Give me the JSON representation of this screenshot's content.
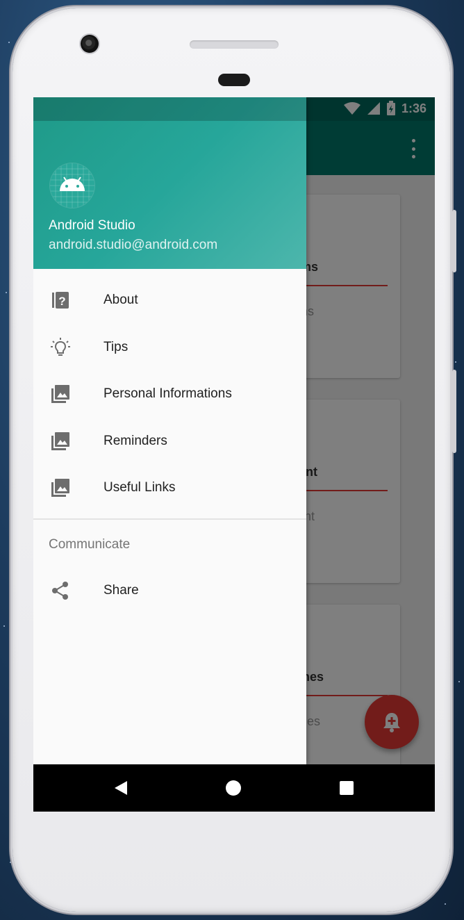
{
  "status_bar": {
    "time": "1:36"
  },
  "drawer": {
    "header": {
      "name": "Android Studio",
      "email": "android.studio@android.com"
    },
    "items": [
      {
        "label": "About",
        "icon": "help-book-icon"
      },
      {
        "label": "Tips",
        "icon": "lightbulb-icon"
      },
      {
        "label": "Personal Informations",
        "icon": "photo-library-icon"
      },
      {
        "label": "Reminders",
        "icon": "photo-library-icon"
      },
      {
        "label": "Useful Links",
        "icon": "photo-library-icon"
      }
    ],
    "section_title": "Communicate",
    "share_label": "Share"
  },
  "cards": [
    {
      "title": "mptoms",
      "subtitle": "mptoms"
    },
    {
      "title": "eatment",
      "subtitle": "eatment"
    },
    {
      "title": "searches",
      "subtitle": "searches"
    }
  ],
  "colors": {
    "primary": "#00796b",
    "primary_dark": "#00695c",
    "accent": "#e53935",
    "header_gradient_start": "#1f9a88",
    "header_gradient_end": "#4db6ac"
  }
}
